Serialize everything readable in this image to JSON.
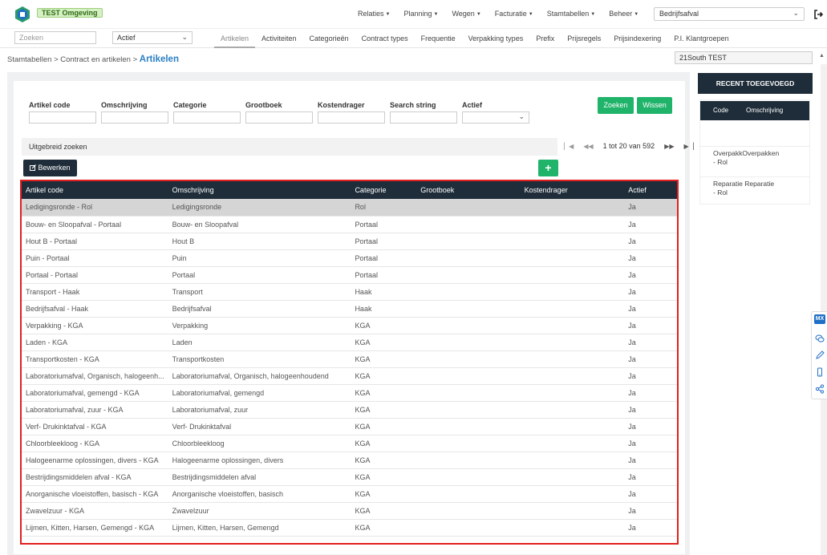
{
  "app": {
    "env_badge": "TEST Omgeving"
  },
  "nav": {
    "items": [
      {
        "label": "Relaties"
      },
      {
        "label": "Planning"
      },
      {
        "label": "Wegen"
      },
      {
        "label": "Facturatie"
      },
      {
        "label": "Stamtabellen"
      },
      {
        "label": "Beheer"
      }
    ],
    "context_select": "Bedrijfsafval"
  },
  "subbar": {
    "search_placeholder": "Zoeken",
    "status_value": "Actief",
    "tabs": [
      {
        "label": "Artikelen",
        "active": true
      },
      {
        "label": "Activiteiten"
      },
      {
        "label": "Categorieën"
      },
      {
        "label": "Contract types"
      },
      {
        "label": "Frequentie"
      },
      {
        "label": "Verpakking types"
      },
      {
        "label": "Prefix"
      },
      {
        "label": "Prijsregels"
      },
      {
        "label": "Prijsindexering"
      },
      {
        "label": "P.I. Klantgroepen"
      }
    ]
  },
  "breadcrumb": {
    "path": "Stamtabellen > Contract en artikelen >",
    "current": "Artikelen"
  },
  "tenant": "21South TEST",
  "filters": {
    "labels": [
      "Artikel code",
      "Omschrijving",
      "Categorie",
      "Grootboek",
      "Kostendrager",
      "Search string",
      "Actief"
    ],
    "search_button": "Zoeken",
    "clear_button": "Wissen"
  },
  "advanced_search": "Uitgebreid zoeken",
  "pager": {
    "text": "1 tot 20 van 592"
  },
  "edit_button": "Bewerken",
  "add_button": "+",
  "table": {
    "columns": [
      "Artikel code",
      "Omschrijving",
      "Categorie",
      "Grootboek",
      "Kostendrager",
      "Actief"
    ],
    "rows": [
      [
        "Ledigingsronde - Rol",
        "Ledigingsronde",
        "Rol",
        "",
        "",
        "Ja"
      ],
      [
        "Bouw- en Sloopafval - Portaal",
        "Bouw- en Sloopafval",
        "Portaal",
        "",
        "",
        "Ja"
      ],
      [
        "Hout B - Portaal",
        "Hout B",
        "Portaal",
        "",
        "",
        "Ja"
      ],
      [
        "Puin - Portaal",
        "Puin",
        "Portaal",
        "",
        "",
        "Ja"
      ],
      [
        "Portaal - Portaal",
        "Portaal",
        "Portaal",
        "",
        "",
        "Ja"
      ],
      [
        "Transport - Haak",
        "Transport",
        "Haak",
        "",
        "",
        "Ja"
      ],
      [
        "Bedrijfsafval - Haak",
        "Bedrijfsafval",
        "Haak",
        "",
        "",
        "Ja"
      ],
      [
        "Verpakking - KGA",
        "Verpakking",
        "KGA",
        "",
        "",
        "Ja"
      ],
      [
        "Laden - KGA",
        "Laden",
        "KGA",
        "",
        "",
        "Ja"
      ],
      [
        "Transportkosten - KGA",
        "Transportkosten",
        "KGA",
        "",
        "",
        "Ja"
      ],
      [
        "Laboratoriumafval, Organisch, halogeenh...",
        "Laboratoriumafval, Organisch, halogeenhoudend",
        "KGA",
        "",
        "",
        "Ja"
      ],
      [
        "Laboratoriumafval, gemengd - KGA",
        "Laboratoriumafval, gemengd",
        "KGA",
        "",
        "",
        "Ja"
      ],
      [
        "Laboratoriumafval, zuur - KGA",
        "Laboratoriumafval, zuur",
        "KGA",
        "",
        "",
        "Ja"
      ],
      [
        "Verf- Drukinktafval - KGA",
        "Verf- Drukinktafval",
        "KGA",
        "",
        "",
        "Ja"
      ],
      [
        "Chloorbleekloog - KGA",
        "Chloorbleekloog",
        "KGA",
        "",
        "",
        "Ja"
      ],
      [
        "Halogeenarme oplossingen, divers - KGA",
        "Halogeenarme oplossingen, divers",
        "KGA",
        "",
        "",
        "Ja"
      ],
      [
        "Bestrijdingsmiddelen afval - KGA",
        "Bestrijdingsmiddelen afval",
        "KGA",
        "",
        "",
        "Ja"
      ],
      [
        "Anorganische vloeistoffen, basisch - KGA",
        "Anorganische vloeistoffen, basisch",
        "KGA",
        "",
        "",
        "Ja"
      ],
      [
        "Zwavelzuur - KGA",
        "Zwavelzuur",
        "KGA",
        "",
        "",
        "Ja"
      ],
      [
        "Lijmen, Kitten, Harsen, Gemengd - KGA",
        "Lijmen, Kitten, Harsen, Gemengd",
        "KGA",
        "",
        "",
        "Ja"
      ]
    ]
  },
  "recent": {
    "title": "RECENT TOEGEVOEGD",
    "columns": [
      "Code",
      "Omschrijving"
    ],
    "items": [
      {
        "line1": "OverpakkOverpakken",
        "line2": "- Rol"
      },
      {
        "line1": "Reparatie Reparatie",
        "line2": "- Rol"
      }
    ]
  },
  "side_tools": {
    "badge": "MX"
  },
  "colors": {
    "accent_green": "#20b36a",
    "dark_header": "#1f2d3a",
    "link_blue": "#2a7fc4",
    "highlight_red": "#e02020"
  }
}
